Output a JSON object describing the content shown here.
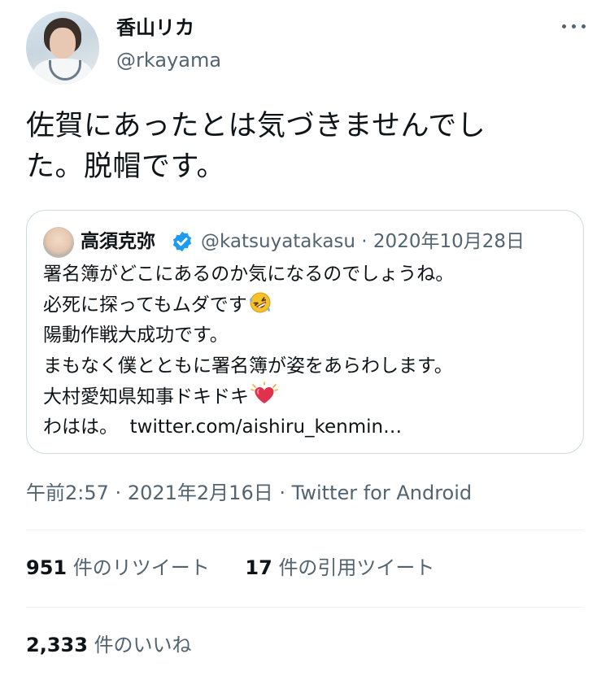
{
  "author": {
    "name": "香山リカ",
    "handle": "@rkayama"
  },
  "tweet": {
    "text": "佐賀にあったとは気づきませんでした。脱帽です。",
    "lines": [
      "佐賀にあったとは気づきませんでし",
      "た。脱帽です。"
    ]
  },
  "quoted_tweet": {
    "name": "高須克弥",
    "handle": "@katsuyatakasu",
    "date": "2020年10月28日",
    "lines": [
      "署名簿がどこにあるのか気になるのでしょうね。",
      "必死に探ってもムダです",
      "陽動作戦大成功です。",
      "まもなく僕とともに署名簿が姿をあらわします。",
      "大村愛知県知事ドキドキ",
      "わはは。"
    ],
    "link": "twitter.com/aishiru_kenmin…"
  },
  "meta": {
    "time": "午前2:57",
    "date": "2021年2月16日",
    "source": "Twitter for Android",
    "separator": "·"
  },
  "stats": {
    "retweets_count": "951",
    "retweets_label": "件のリツイート",
    "quotes_count": "17",
    "quotes_label": "件の引用ツイート",
    "likes_count": "2,333",
    "likes_label": "件のいいね"
  },
  "icons": {
    "more": "more-horizontal-icon",
    "verified": "verified-badge-icon",
    "laughing_emoji": "rolling-on-floor-laughing-emoji",
    "heart_emoji": "beating-heart-emoji"
  },
  "colors": {
    "text": "#0f1419",
    "secondary": "#536471",
    "verified": "#1d9bf0",
    "border": "#cfd9de",
    "divider": "#eff3f4"
  }
}
